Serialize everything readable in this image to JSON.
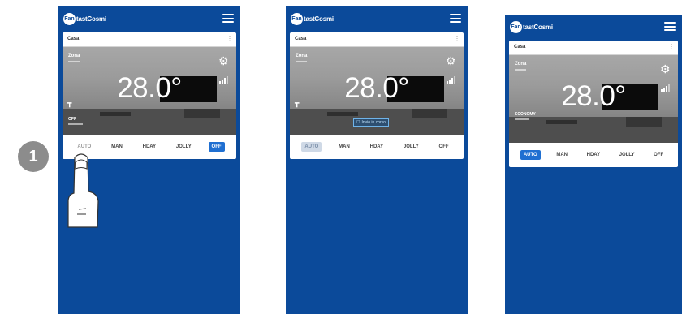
{
  "step_number": "1",
  "app": {
    "logo_mark": "Fan",
    "logo_text": "tastCosmi",
    "location": "Casa",
    "zone": "Zona",
    "temperature": "28.0°"
  },
  "screens": [
    {
      "status_text": "OFF",
      "modes": [
        "AUTO",
        "MAN",
        "HDAY",
        "JOLLY",
        "OFF"
      ],
      "active_mode": "OFF",
      "pressed_mode": "AUTO"
    },
    {
      "status_text": "",
      "notice": "Invio in corso",
      "modes": [
        "AUTO",
        "MAN",
        "HDAY",
        "JOLLY",
        "OFF"
      ],
      "pending_mode": "AUTO"
    },
    {
      "status_text": "ECONOMY",
      "modes": [
        "AUTO",
        "MAN",
        "HDAY",
        "JOLLY",
        "OFF"
      ],
      "active_mode": "AUTO"
    }
  ],
  "colors": {
    "app_blue": "#0b4a9a",
    "active_blue": "#1f6fd1",
    "badge_gray": "#8c8c8c"
  },
  "icons": [
    "menu-icon",
    "gear-icon",
    "signal-icon",
    "tap-icon",
    "hand-pointer-icon",
    "check-icon"
  ]
}
